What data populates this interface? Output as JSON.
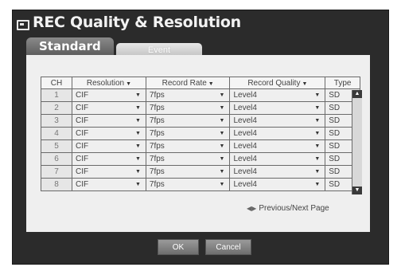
{
  "window": {
    "title": "REC Quality & Resolution"
  },
  "tabs": [
    {
      "label": "Standard"
    },
    {
      "label": "Event"
    }
  ],
  "table": {
    "headers": [
      "CH",
      "Resolution",
      "Record Rate",
      "Record Quality",
      "Type"
    ],
    "rows": [
      {
        "ch": "1",
        "resolution": "CIF",
        "rate": "7fps",
        "quality": "Level4",
        "type": "SD"
      },
      {
        "ch": "2",
        "resolution": "CIF",
        "rate": "7fps",
        "quality": "Level4",
        "type": "SD"
      },
      {
        "ch": "3",
        "resolution": "CIF",
        "rate": "7fps",
        "quality": "Level4",
        "type": "SD"
      },
      {
        "ch": "4",
        "resolution": "CIF",
        "rate": "7fps",
        "quality": "Level4",
        "type": "SD"
      },
      {
        "ch": "5",
        "resolution": "CIF",
        "rate": "7fps",
        "quality": "Level4",
        "type": "SD"
      },
      {
        "ch": "6",
        "resolution": "CIF",
        "rate": "7fps",
        "quality": "Level4",
        "type": "SD"
      },
      {
        "ch": "7",
        "resolution": "CIF",
        "rate": "7fps",
        "quality": "Level4",
        "type": "SD"
      },
      {
        "ch": "8",
        "resolution": "CIF",
        "rate": "7fps",
        "quality": "Level4",
        "type": "SD"
      }
    ]
  },
  "pager": {
    "label": "Previous/Next Page"
  },
  "buttons": {
    "ok": "OK",
    "cancel": "Cancel"
  },
  "icons": [
    "window-icon",
    "dropdown-arrow-icon",
    "scroll-up-icon",
    "scroll-down-icon",
    "page-nav-icon"
  ]
}
